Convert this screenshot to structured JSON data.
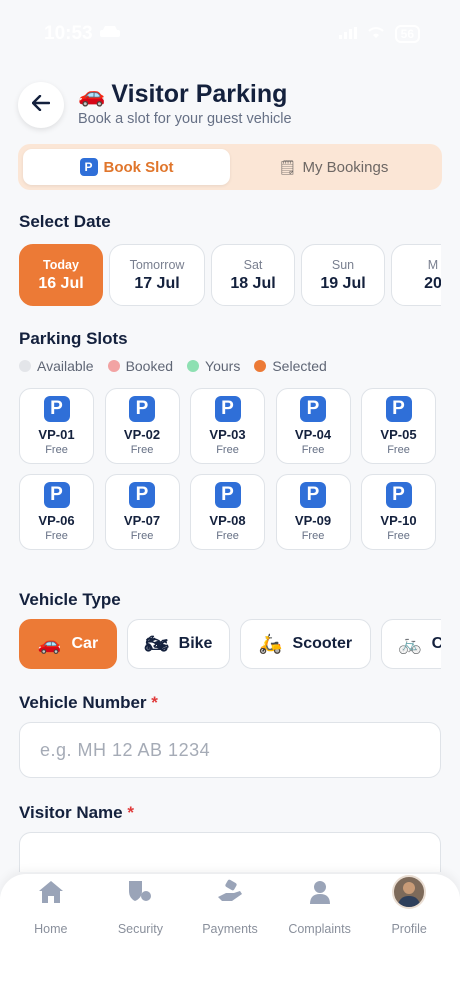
{
  "status_bar": {
    "time": "10:53",
    "battery": "56"
  },
  "header": {
    "emoji": "🚗",
    "title": "Visitor Parking",
    "subtitle": "Book a slot for your guest vehicle",
    "back_icon": "arrow-left-icon"
  },
  "tabs": [
    {
      "label": "Book Slot",
      "icon": "P",
      "active": true
    },
    {
      "label": "My Bookings",
      "icon": "🗒",
      "active": false
    }
  ],
  "select_date": {
    "title": "Select Date",
    "dates": [
      {
        "day": "Today",
        "date": "16 Jul",
        "selected": true
      },
      {
        "day": "Tomorrow",
        "date": "17 Jul",
        "selected": false
      },
      {
        "day": "Sat",
        "date": "18 Jul",
        "selected": false
      },
      {
        "day": "Sun",
        "date": "19 Jul",
        "selected": false
      },
      {
        "day": "M",
        "date": "20",
        "selected": false
      }
    ]
  },
  "parking_slots": {
    "title": "Parking Slots",
    "legend": [
      {
        "label": "Available",
        "color": "#e3e5e9"
      },
      {
        "label": "Booked",
        "color": "#f2a3a3"
      },
      {
        "label": "Yours",
        "color": "#8ee0b2"
      },
      {
        "label": "Selected",
        "color": "#ec7a36"
      }
    ],
    "slots": [
      {
        "id": "VP-01",
        "status": "Free"
      },
      {
        "id": "VP-02",
        "status": "Free"
      },
      {
        "id": "VP-03",
        "status": "Free"
      },
      {
        "id": "VP-04",
        "status": "Free"
      },
      {
        "id": "VP-05",
        "status": "Free"
      },
      {
        "id": "VP-06",
        "status": "Free"
      },
      {
        "id": "VP-07",
        "status": "Free"
      },
      {
        "id": "VP-08",
        "status": "Free"
      },
      {
        "id": "VP-09",
        "status": "Free"
      },
      {
        "id": "VP-10",
        "status": "Free"
      }
    ]
  },
  "vehicle_type": {
    "title": "Vehicle Type",
    "options": [
      {
        "emoji": "🚗",
        "label": "Car",
        "selected": true
      },
      {
        "emoji": "🏍",
        "label": "Bike",
        "selected": false
      },
      {
        "emoji": "🛵",
        "label": "Scooter",
        "selected": false
      },
      {
        "emoji": "🚲",
        "label": "C",
        "selected": false
      }
    ]
  },
  "vehicle_number": {
    "label": "Vehicle Number",
    "required_mark": "*",
    "placeholder": "e.g. MH 12 AB 1234",
    "value": ""
  },
  "visitor_name": {
    "label": "Visitor Name",
    "required_mark": "*"
  },
  "bottom_nav": [
    {
      "label": "Home",
      "icon": "home-icon"
    },
    {
      "label": "Security",
      "icon": "security-shield-icon"
    },
    {
      "label": "Payments",
      "icon": "payments-hand-icon"
    },
    {
      "label": "Complaints",
      "icon": "complaints-person-icon"
    },
    {
      "label": "Profile",
      "icon": "profile-avatar"
    }
  ],
  "colors": {
    "accent": "#ec7a36",
    "parking_blue": "#2f6fd8",
    "heading": "#14213d"
  }
}
